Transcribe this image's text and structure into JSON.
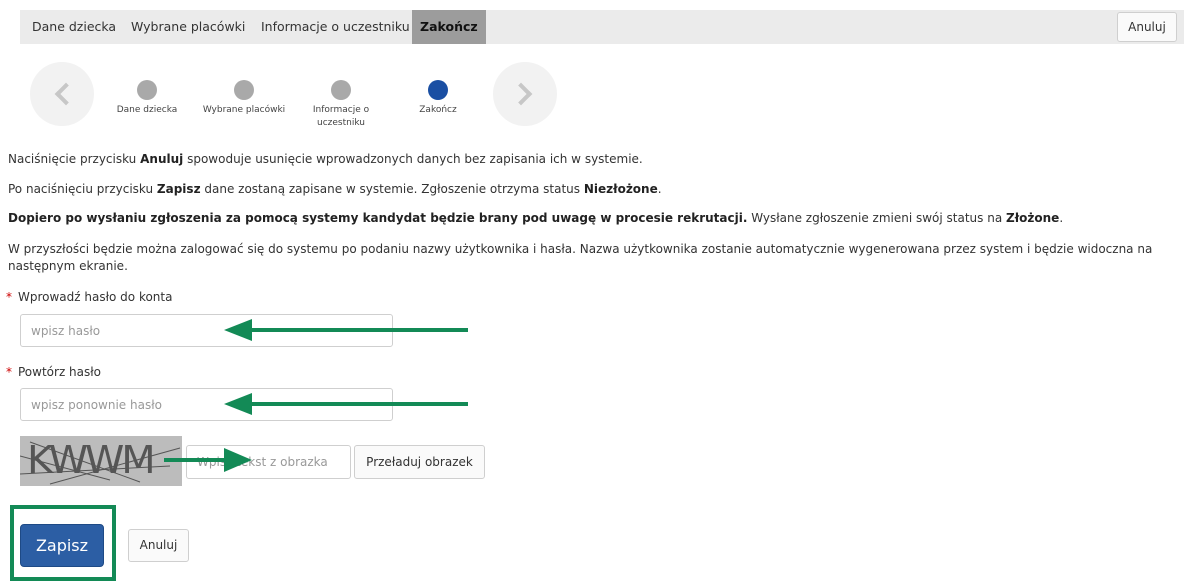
{
  "tabs": [
    {
      "label": "Dane dziecka",
      "active": false
    },
    {
      "label": "Wybrane placówki",
      "active": false
    },
    {
      "label": "Informacje o uczestniku",
      "active": false
    },
    {
      "label": "Zakończ",
      "active": true
    }
  ],
  "top_cancel_label": "Anuluj",
  "wizard": {
    "steps": [
      {
        "label": "Dane dziecka",
        "active": false
      },
      {
        "label": "Wybrane placówki",
        "active": false
      },
      {
        "label_line1": "Informacje o",
        "label_line2": "uczestniku",
        "active": false
      },
      {
        "label": "Zakończ",
        "active": true
      }
    ],
    "prev_icon": "chevron-left-icon",
    "next_icon": "chevron-right-icon"
  },
  "info": {
    "p1": {
      "a": "Naciśnięcie przycisku ",
      "b": "Anuluj",
      "c": " spowoduje usunięcie wprowadzonych danych bez zapisania ich w systemie."
    },
    "p2": {
      "a": "Po naciśnięciu przycisku ",
      "b": "Zapisz",
      "c": " dane zostaną zapisane w systemie.  Zgłoszenie otrzyma status ",
      "d": "Niezłożone",
      "e": "."
    },
    "p3": {
      "a": "Dopiero po wysłaniu zgłoszenia za pomocą systemy kandydat będzie brany pod uwagę w procesie rekrutacji.",
      "b": " Wysłane zgłoszenie zmieni swój status na ",
      "c": "Złożone",
      "d": "."
    },
    "p4_line1": "W przyszłości będzie można zalogować się do systemu po podaniu nazwy użytkownika i hasła. Nazwa użytkownika zostanie automatycznie wygenerowana przez system i będzie widoczna na",
    "p4_line2": "następnym ekranie."
  },
  "form": {
    "required_mark": "*",
    "password_label": "Wprowadź hasło do konta",
    "password_placeholder": "wpisz hasło",
    "repeat_label": "Powtórz hasło",
    "repeat_placeholder": "wpisz ponownie hasło",
    "captcha_text": "KWWM",
    "captcha_placeholder": "Wpisz tekst z obrazka",
    "reload_label": "Przeładuj obrazek"
  },
  "actions": {
    "save_label": "Zapisz",
    "cancel_label": "Anuluj"
  },
  "colors": {
    "accent": "#2c5ea4",
    "annotation": "#138a56",
    "active_step": "#1a4fa3"
  }
}
